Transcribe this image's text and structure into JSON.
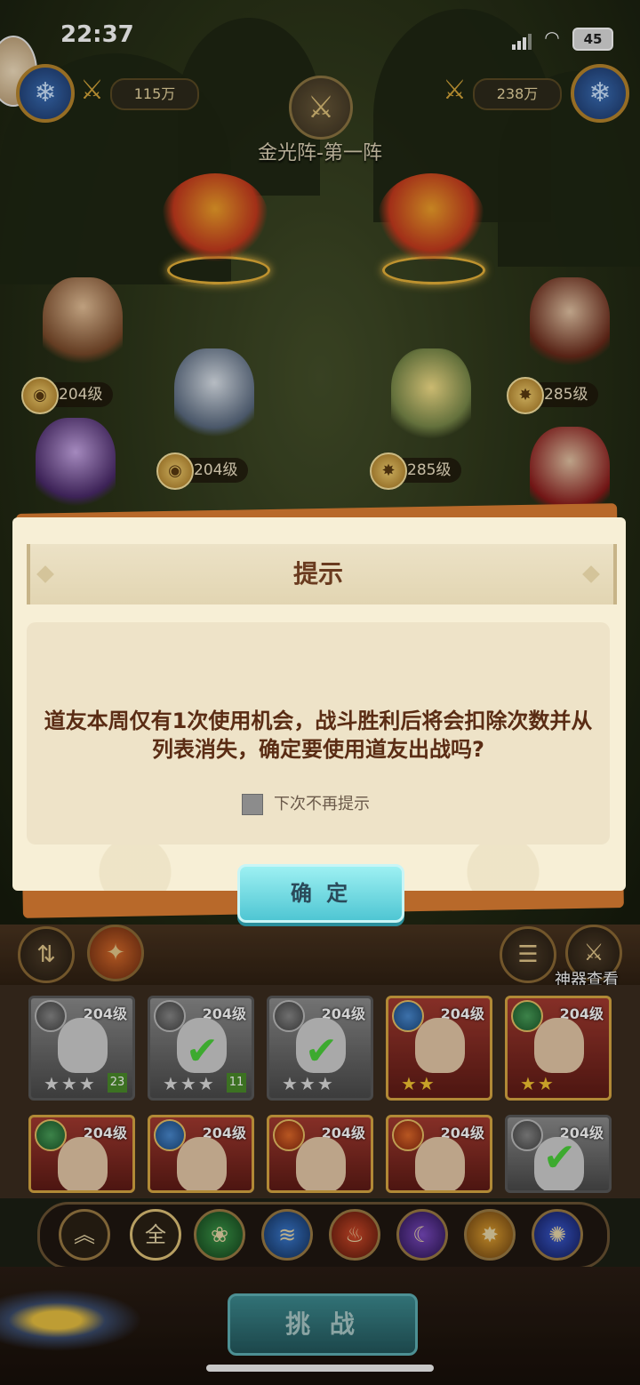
{
  "status_bar": {
    "time": "22:37",
    "battery": "45"
  },
  "top": {
    "left_power": "115万",
    "right_power": "238万",
    "formation_title": "金光阵-第一阵"
  },
  "battle_units": {
    "levels": [
      "204级",
      "204级",
      "285级",
      "285级"
    ]
  },
  "dialog": {
    "title": "提示",
    "message": "道友本周仅有1次使用机会，战斗胜利后将会扣除次数并从列表消失，确定要使用道友出战吗?",
    "checkbox_label": "下次不再提示",
    "checkbox_checked": false,
    "confirm_label": "确 定"
  },
  "toolbar": {
    "artifact_view_label": "神器查看"
  },
  "roster": {
    "row1": [
      {
        "level": "204级",
        "style": "gray",
        "checked": false,
        "badge": "23"
      },
      {
        "level": "204级",
        "style": "gray",
        "checked": true,
        "badge": "11"
      },
      {
        "level": "204级",
        "style": "gray",
        "checked": true,
        "badge": ""
      },
      {
        "level": "204级",
        "style": "gold",
        "checked": false,
        "badge": ""
      },
      {
        "level": "204级",
        "style": "gold",
        "checked": false,
        "badge": ""
      }
    ],
    "row2": [
      {
        "level": "204级",
        "style": "gold"
      },
      {
        "level": "204级",
        "style": "gold"
      },
      {
        "level": "204级",
        "style": "gold"
      },
      {
        "level": "204级",
        "style": "gold"
      },
      {
        "level": "204级",
        "style": "gray"
      }
    ]
  },
  "filters": {
    "all_label": "全",
    "colors": [
      "#c9a14a",
      "#c9a14a",
      "#3c9a4a",
      "#3a7ad0",
      "#d04a2a",
      "#7a4ac0",
      "#e0a030",
      "#3a5ad0"
    ]
  },
  "bottom": {
    "challenge_label": "挑 战"
  }
}
